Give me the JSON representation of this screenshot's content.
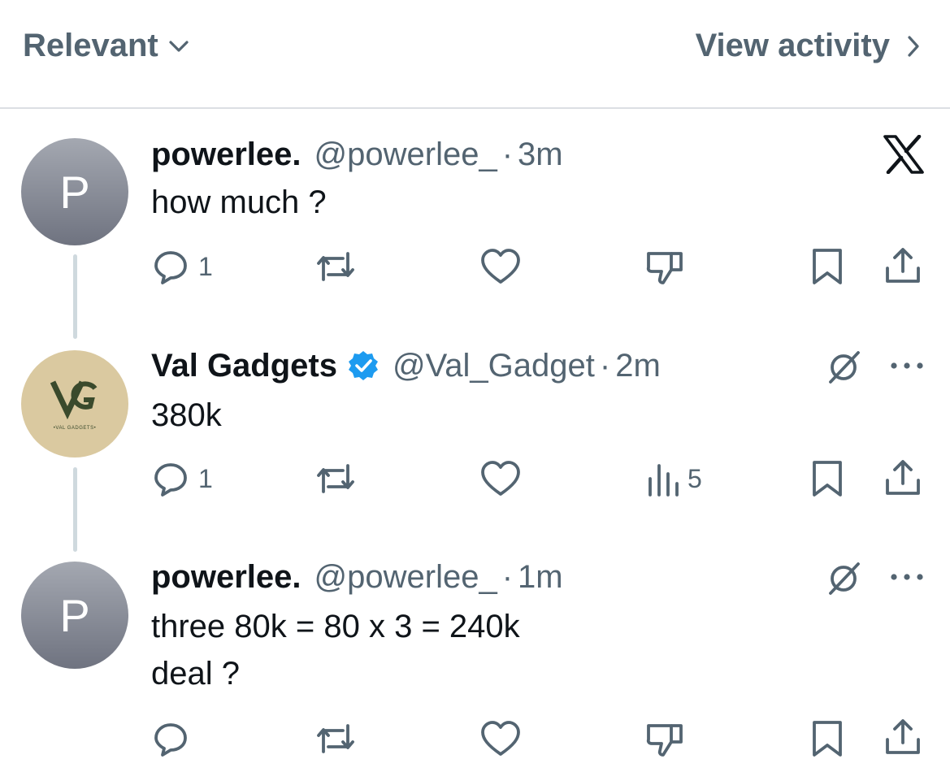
{
  "header": {
    "sort_label": "Relevant",
    "view_activity_label": "View activity"
  },
  "tweets": [
    {
      "name": "powerlee.",
      "handle": "@powerlee_",
      "time": "3m",
      "text": "how much ?",
      "avatar_letter": "P",
      "reply_count": "1",
      "views": ""
    },
    {
      "name": "Val Gadgets",
      "handle": "@Val_Gadget",
      "time": "2m",
      "text": "380k",
      "avatar_label": "•VAL GADGETS•",
      "reply_count": "1",
      "views": "5"
    },
    {
      "name": "powerlee.",
      "handle": "@powerlee_",
      "time": "1m",
      "text_line1": "three 80k = 80 x 3 = 240k",
      "text_line2": "deal ?",
      "avatar_letter": "P",
      "reply_count": "",
      "views": ""
    }
  ],
  "separator": "·",
  "colors": {
    "secondary_text": "#536471",
    "primary_text": "#0f1419",
    "verified_blue": "#1d9bf0",
    "val_avatar_bg": "#dac9a0",
    "val_logo_green": "#3a4a2c"
  },
  "icons": [
    "chevron-down-icon",
    "chevron-right-icon",
    "x-logo-icon",
    "reply-icon",
    "retweet-icon",
    "like-icon",
    "dislike-icon",
    "bookmark-icon",
    "share-icon",
    "grok-icon",
    "more-icon",
    "views-icon",
    "verified-badge-icon"
  ]
}
